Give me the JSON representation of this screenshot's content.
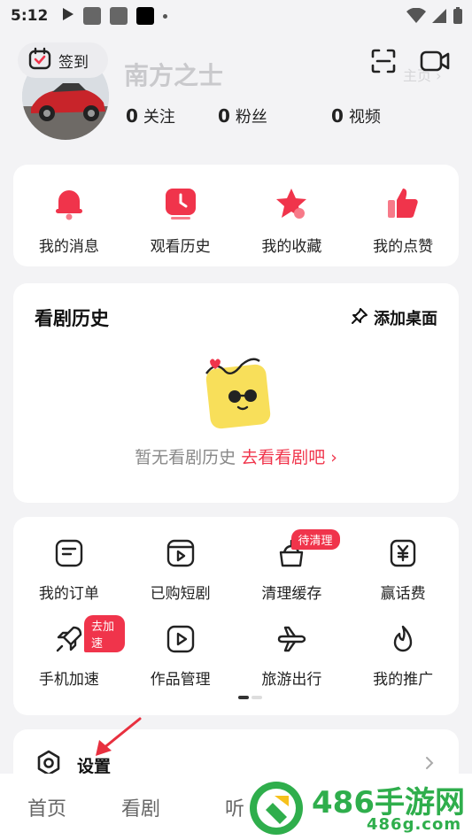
{
  "status_bar": {
    "time": "5:12"
  },
  "header": {
    "checkin_label": "签到",
    "username": "南方之士",
    "homepage_link": "主页 ›",
    "stats": [
      {
        "num": "0",
        "label": "关注"
      },
      {
        "num": "0",
        "label": "粉丝"
      },
      {
        "num": "0",
        "label": "视频"
      }
    ]
  },
  "quick_links": [
    {
      "label": "我的消息",
      "icon": "bell-icon"
    },
    {
      "label": "观看历史",
      "icon": "clock-icon"
    },
    {
      "label": "我的收藏",
      "icon": "star-icon"
    },
    {
      "label": "我的点赞",
      "icon": "thumb-up-icon"
    }
  ],
  "history": {
    "title": "看剧历史",
    "add_desktop": "添加桌面",
    "empty_text": "暂无看剧历史",
    "go_watch": "去看看剧吧 ›"
  },
  "tools": [
    {
      "label": "我的订单",
      "icon": "order-icon",
      "badge": ""
    },
    {
      "label": "已购短剧",
      "icon": "purchased-drama-icon",
      "badge": ""
    },
    {
      "label": "清理缓存",
      "icon": "broom-icon",
      "badge": "待清理"
    },
    {
      "label": "赢话费",
      "icon": "yuan-icon",
      "badge": ""
    },
    {
      "label": "手机加速",
      "icon": "rocket-icon",
      "badge": "去加速"
    },
    {
      "label": "作品管理",
      "icon": "works-icon",
      "badge": ""
    },
    {
      "label": "旅游出行",
      "icon": "plane-icon",
      "badge": ""
    },
    {
      "label": "我的推广",
      "icon": "flame-icon",
      "badge": ""
    }
  ],
  "settings": {
    "label": "设置"
  },
  "bottom_nav": {
    "tabs": [
      "首页",
      "看剧",
      "听"
    ]
  },
  "watermark": {
    "brand": "486手游网",
    "domain": "486g.com"
  },
  "colors": {
    "accent": "#f0344b",
    "background": "#f3f3f5",
    "watermark_green": "#2fae4c"
  }
}
